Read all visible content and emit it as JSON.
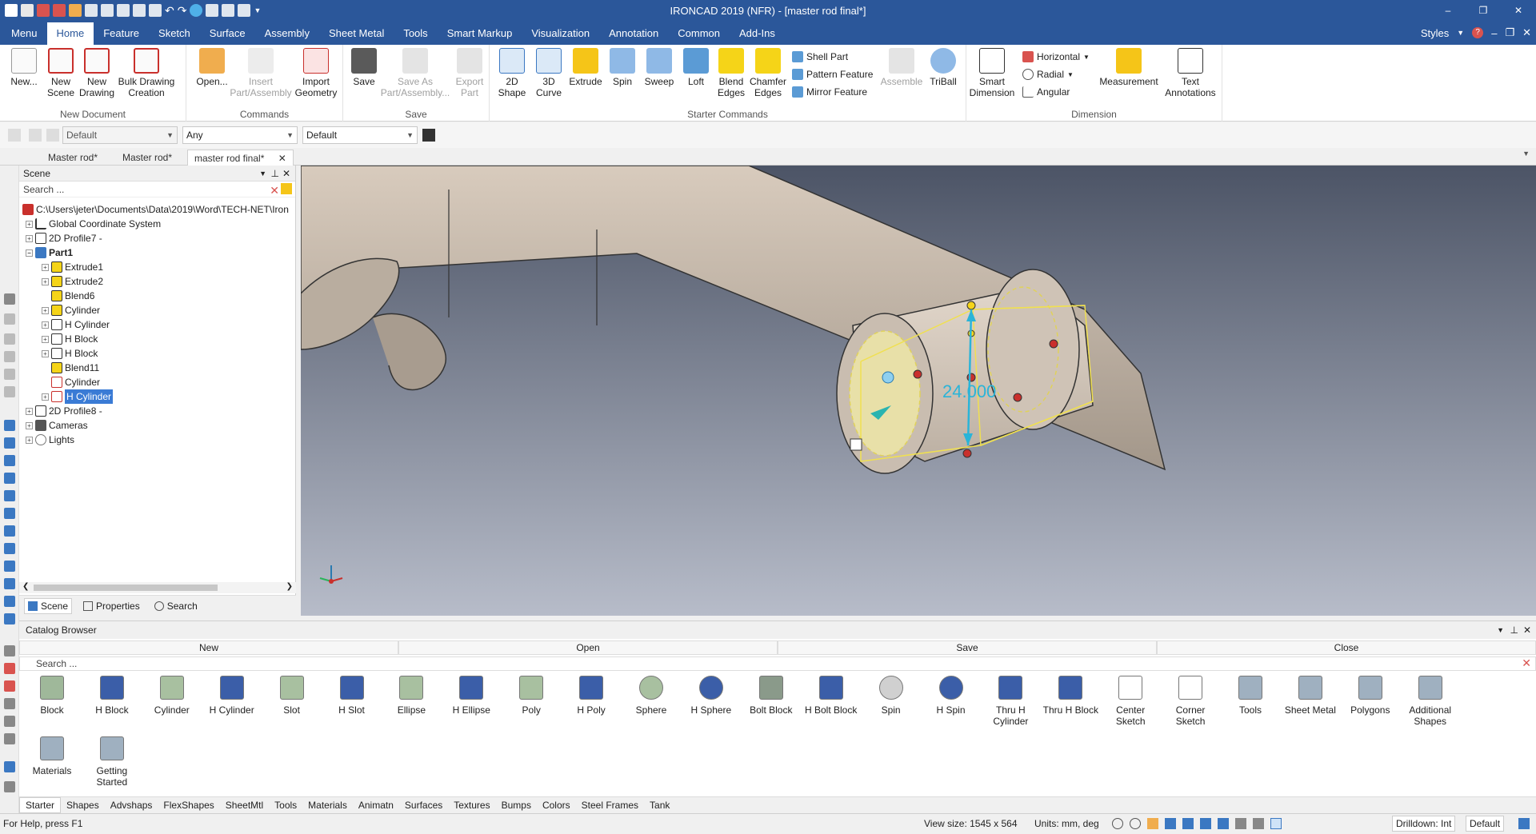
{
  "window": {
    "title": "IRONCAD 2019 (NFR) - [master rod final*]",
    "controls": [
      "–",
      "❐",
      "✕"
    ]
  },
  "ribbon_tabs": [
    "Menu",
    "Home",
    "Feature",
    "Sketch",
    "Surface",
    "Assembly",
    "Sheet Metal",
    "Tools",
    "Smart Markup",
    "Visualization",
    "Annotation",
    "Common",
    "Add-Ins"
  ],
  "styles_label": "Styles",
  "ribbon": {
    "new_document": {
      "label": "New Document",
      "buttons": [
        "New...",
        "New Scene",
        "New Drawing",
        "Bulk Drawing Creation"
      ]
    },
    "commands": {
      "label": "Commands",
      "buttons": [
        "Open...",
        "Insert Part/Assembly",
        "Import Geometry"
      ]
    },
    "save": {
      "label": "Save",
      "buttons": [
        "Save",
        "Save As Part/Assembly...",
        "Export Part"
      ]
    },
    "starter": {
      "label": "Starter Commands",
      "buttons": [
        "2D Shape",
        "3D Curve",
        "Extrude",
        "Spin",
        "Sweep",
        "Loft",
        "Blend Edges",
        "Chamfer Edges"
      ],
      "small": [
        "Shell Part",
        "Pattern Feature",
        "Mirror Feature"
      ],
      "buttons2": [
        "Assemble",
        "TriBall"
      ]
    },
    "dimension": {
      "label": "Dimension",
      "smart": "Smart Dimension",
      "small": [
        "Horizontal",
        "Radial",
        "Angular"
      ],
      "buttons": [
        "Measurement",
        "Text Annotations"
      ]
    }
  },
  "toolbar": {
    "combo1": "Default",
    "combo2": "Any",
    "combo3": "Default"
  },
  "doc_tabs": [
    "Master rod*",
    "Master rod*",
    "master rod final*"
  ],
  "scene": {
    "title": "Scene",
    "search_placeholder": "Search ...",
    "path": "C:\\Users\\jeter\\Documents\\Data\\2019\\Word\\TECH-NET\\Iron",
    "tree": [
      "Global Coordinate System",
      "2D Profile7 -",
      "Part1",
      "Extrude1",
      "Extrude2",
      "Blend6",
      "Cylinder",
      "H Cylinder",
      "H Block",
      "H Block",
      "Blend11",
      "Cylinder",
      "H Cylinder",
      "2D Profile8 -",
      "Cameras",
      "Lights"
    ],
    "tabs": [
      "Scene",
      "Properties",
      "Search"
    ]
  },
  "viewport": {
    "dimension_value": "24.000"
  },
  "catalog": {
    "title": "Catalog Browser",
    "actions": [
      "New",
      "Open",
      "Save",
      "Close"
    ],
    "search_placeholder": "Search ...",
    "items": [
      "Block",
      "H Block",
      "Cylinder",
      "H Cylinder",
      "Slot",
      "H Slot",
      "Ellipse",
      "H Ellipse",
      "Poly",
      "H Poly",
      "Sphere",
      "H Sphere",
      "Bolt Block",
      "H Bolt Block",
      "Spin",
      "H Spin",
      "Thru H Cylinder",
      "Thru H Block",
      "Center Sketch",
      "Corner Sketch",
      "Tools",
      "Sheet Metal",
      "Polygons",
      "Additional Shapes",
      "Materials",
      "Getting Started"
    ],
    "tabs": [
      "Starter",
      "Shapes",
      "Advshaps",
      "FlexShapes",
      "SheetMtl",
      "Tools",
      "Materials",
      "Animatn",
      "Surfaces",
      "Textures",
      "Bumps",
      "Colors",
      "Steel Frames",
      "Tank"
    ]
  },
  "status": {
    "help": "For Help, press F1",
    "view_size": "View size: 1545 x  564",
    "units": "Units: mm, deg",
    "drilldown": "Drilldown: Int",
    "default": "Default"
  }
}
